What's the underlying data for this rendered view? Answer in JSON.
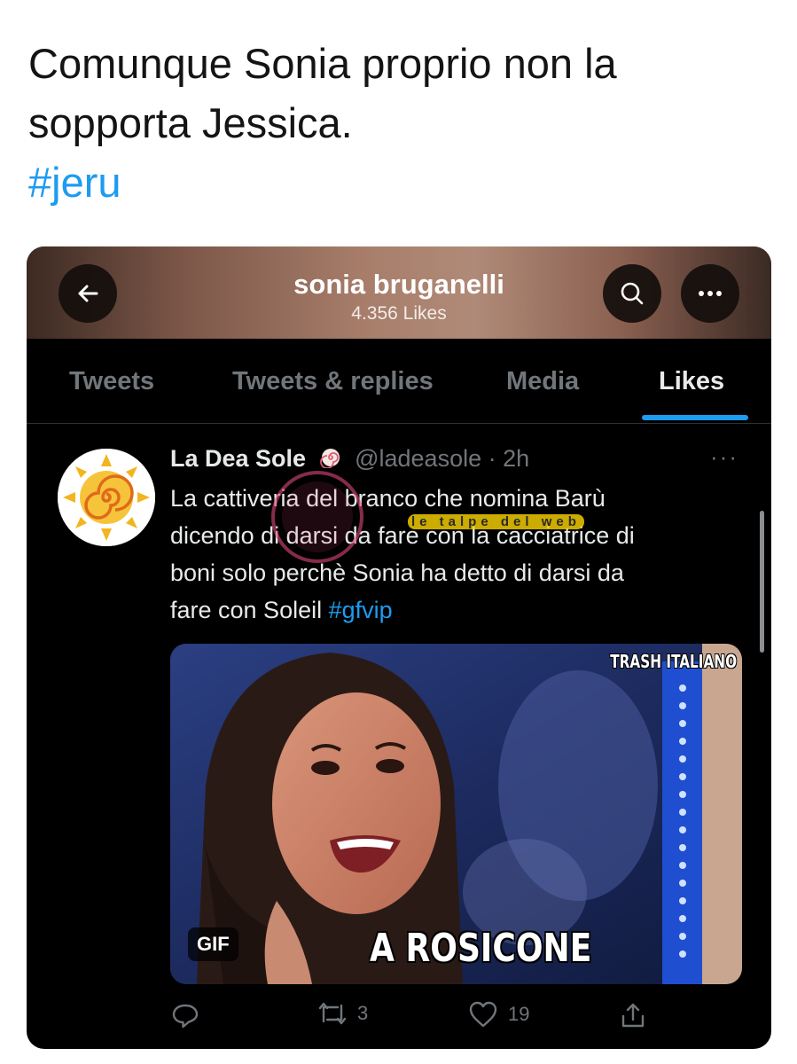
{
  "post": {
    "lines": [
      "Comunque Sonia proprio non la",
      "sopporta Jessica."
    ],
    "hashtag": "#jeru"
  },
  "screenshot": {
    "header": {
      "name": "sonia bruganelli",
      "likes": "4.356 Likes",
      "icons": [
        "back-arrow-icon",
        "search-icon",
        "more-icon"
      ]
    },
    "tabs": [
      {
        "label": "Tweets",
        "active": false
      },
      {
        "label": "Tweets & replies",
        "active": false
      },
      {
        "label": "Media",
        "active": false
      },
      {
        "label": "Likes",
        "active": true
      }
    ],
    "tweet": {
      "author": "La Dea Sole",
      "handle": "@ladeasole · 2h",
      "more": "···",
      "lines": [
        "La cattiveria del branco che nomina Barù",
        "dicendo di darsi da fare con la cacciatrice di",
        "boni solo perchè Sonia ha detto di darsi da",
        "fare con Soleil "
      ],
      "hashtag": "#gfvip",
      "media": {
        "gif_label": "GIF",
        "top_caption": "TRASH ITALIANO",
        "bottom_caption": "A ROSICONE"
      },
      "actions": {
        "reply": "",
        "retweets": "3",
        "likes": "19",
        "share": ""
      }
    },
    "watermark": "le talpe del web"
  },
  "colors": {
    "accent": "#1d9bf0",
    "card_bg": "#000000",
    "muted": "#71767b",
    "text": "#e7e9ea"
  }
}
